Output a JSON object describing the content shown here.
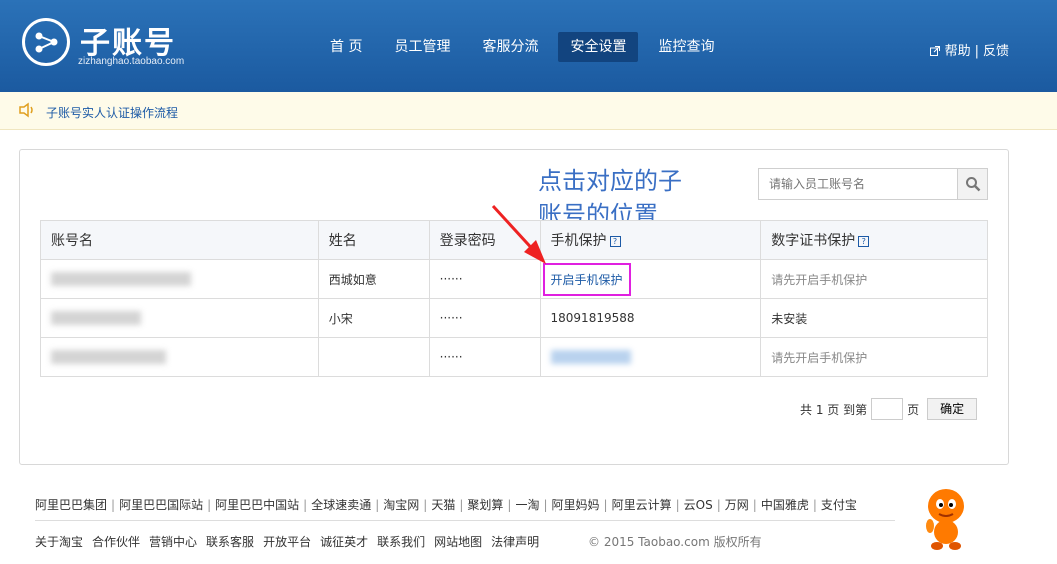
{
  "header": {
    "brand": "子账号",
    "brand_sub": "zizhanghao.taobao.com",
    "nav": [
      "首 页",
      "员工管理",
      "客服分流",
      "安全设置",
      "监控查询"
    ],
    "active_nav": "安全设置",
    "help": "帮助",
    "feedback": "反馈",
    "separator": "|"
  },
  "notice": {
    "text": "子账号实人认证操作流程"
  },
  "annotation": {
    "line1": "点击对应的子",
    "line2": "账号的位置"
  },
  "search": {
    "placeholder": "请输入员工账号名"
  },
  "table": {
    "headers": [
      "账号名",
      "姓名",
      "登录密码",
      "手机保护",
      "数字证书保护"
    ],
    "rows": [
      {
        "name": "西城如意",
        "password": "······",
        "phone": "开启手机保护",
        "cert": "请先开启手机保护"
      },
      {
        "name": "小宋",
        "password": "······",
        "phone": "18091819588",
        "cert": "未安装"
      },
      {
        "name": "",
        "password": "······",
        "phone": "",
        "cert": "请先开启手机保护"
      }
    ]
  },
  "pager": {
    "prefix": "共 1 页 到第",
    "suffix": "页",
    "confirm": "确定"
  },
  "footer": {
    "links": [
      "阿里巴巴集团",
      "阿里巴巴国际站",
      "阿里巴巴中国站",
      "全球速卖通",
      "淘宝网",
      "天猫",
      "聚划算",
      "一淘",
      "阿里妈妈",
      "阿里云计算",
      "云OS",
      "万网",
      "中国雅虎",
      "支付宝"
    ],
    "links2": [
      "关于淘宝",
      "合作伙伴",
      "营销中心",
      "联系客服",
      "开放平台",
      "诚征英才",
      "联系我们",
      "网站地图",
      "法律声明"
    ],
    "copyright": "© 2015 Taobao.com 版权所有"
  }
}
